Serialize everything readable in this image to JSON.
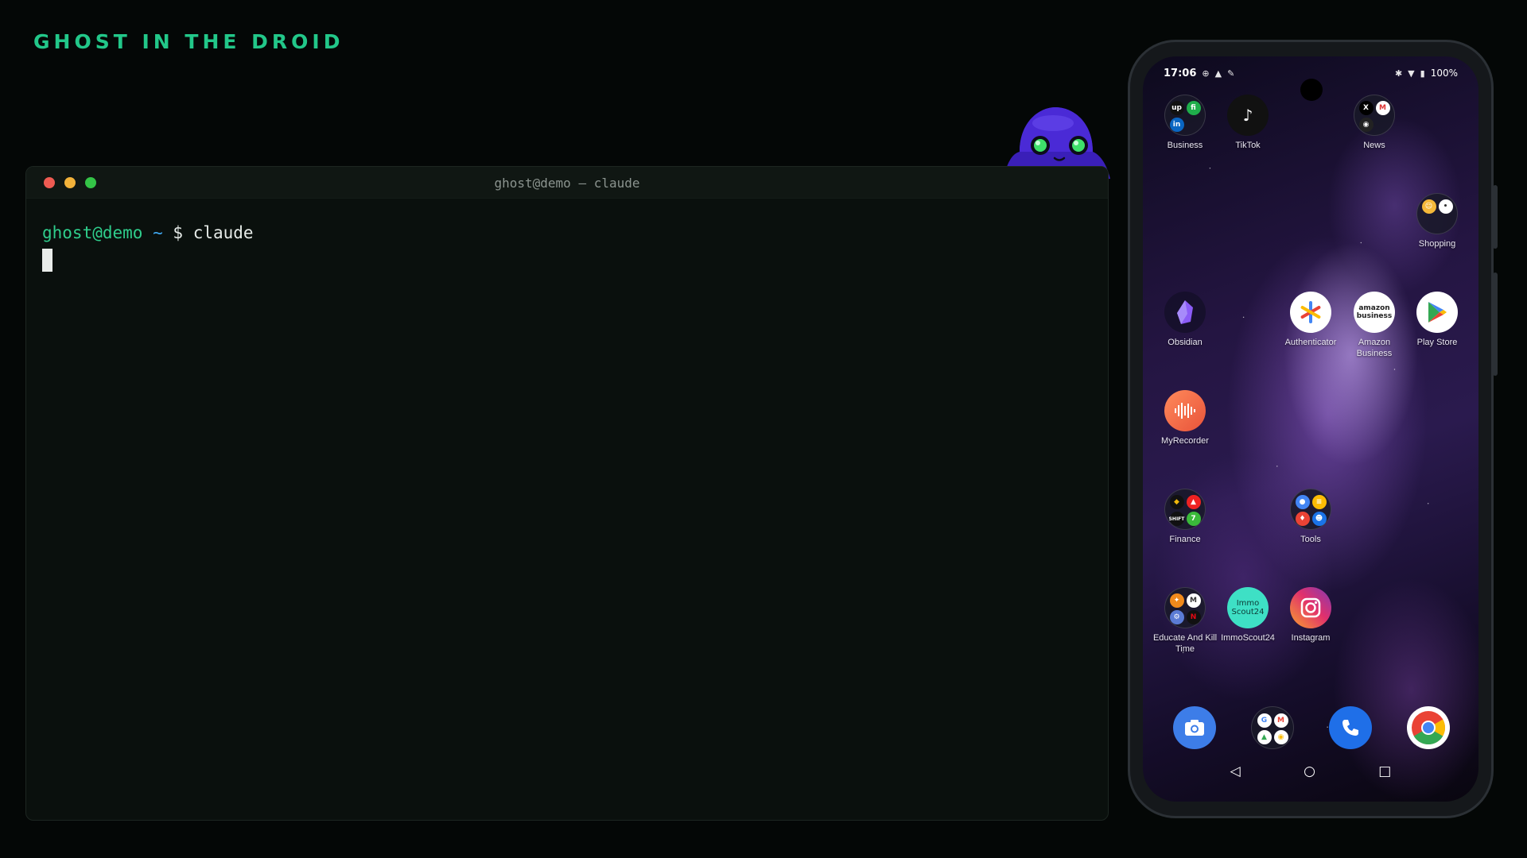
{
  "brand": {
    "title": "GHOST IN THE DROID"
  },
  "colors": {
    "accent": "#22c789",
    "terminal_bg": "#0a100d",
    "prompt_user": "#2fce8c",
    "prompt_tilde": "#3fa8f0"
  },
  "terminal": {
    "window_title": "ghost@demo — claude",
    "prompt_user": "ghost@demo",
    "prompt_path": "~",
    "prompt_symbol": "$",
    "command": "claude"
  },
  "phone": {
    "status": {
      "time": "17:06",
      "battery": "100%"
    },
    "apps": {
      "business": {
        "label": "Business",
        "icon": "folder-icon"
      },
      "tiktok": {
        "label": "TikTok",
        "icon": "tiktok-icon"
      },
      "news": {
        "label": "News",
        "icon": "folder-icon"
      },
      "shopping": {
        "label": "Shopping",
        "icon": "folder-icon"
      },
      "obsidian": {
        "label": "Obsidian",
        "icon": "obsidian-icon"
      },
      "authenticator": {
        "label": "Authenticator",
        "icon": "authenticator-icon"
      },
      "amazon_business": {
        "label": "Amazon Business",
        "icon": "amazon-icon",
        "icon_text": "amazon business"
      },
      "play_store": {
        "label": "Play Store",
        "icon": "play-store-icon"
      },
      "myrecorder": {
        "label": "MyRecorder",
        "icon": "recorder-icon"
      },
      "finance": {
        "label": "Finance",
        "icon": "folder-icon"
      },
      "tools": {
        "label": "Tools",
        "icon": "folder-icon"
      },
      "educate": {
        "label": "Educate And Kill Time",
        "icon": "folder-icon"
      },
      "immoscout": {
        "label": "ImmoScout24",
        "icon": "immoscout-icon",
        "icon_text": "Immo Scout24"
      },
      "instagram": {
        "label": "Instagram",
        "icon": "instagram-icon"
      }
    },
    "dock": [
      "camera-icon",
      "google-folder-icon",
      "phone-icon",
      "chrome-icon"
    ],
    "nav": {
      "back": "◁",
      "home": "○",
      "recents": "□"
    }
  }
}
